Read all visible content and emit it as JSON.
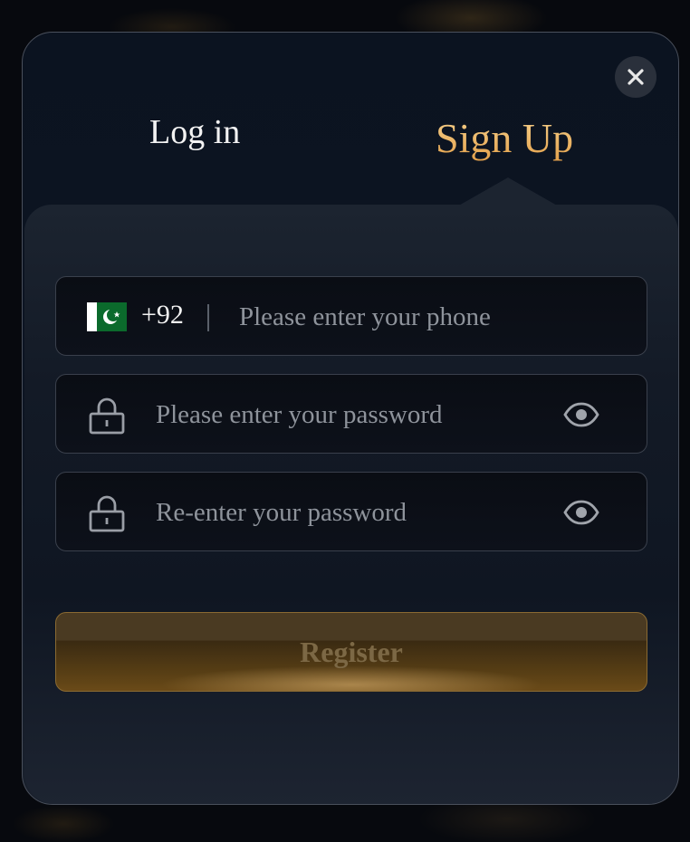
{
  "tabs": {
    "login": "Log in",
    "signup": "Sign Up"
  },
  "phone": {
    "country_code": "+92",
    "placeholder": "Please enter your phone",
    "flag": "pakistan-flag"
  },
  "password": {
    "placeholder": "Please enter your password"
  },
  "confirm_password": {
    "placeholder": "Re-enter your password"
  },
  "register": {
    "label": "Register"
  },
  "colors": {
    "accent_gold": "#e9b15a",
    "panel_bg": "#0d1523",
    "field_border": "#3a404c"
  },
  "icons": {
    "close": "close-icon",
    "lock": "lock-icon",
    "eye": "eye-icon"
  }
}
